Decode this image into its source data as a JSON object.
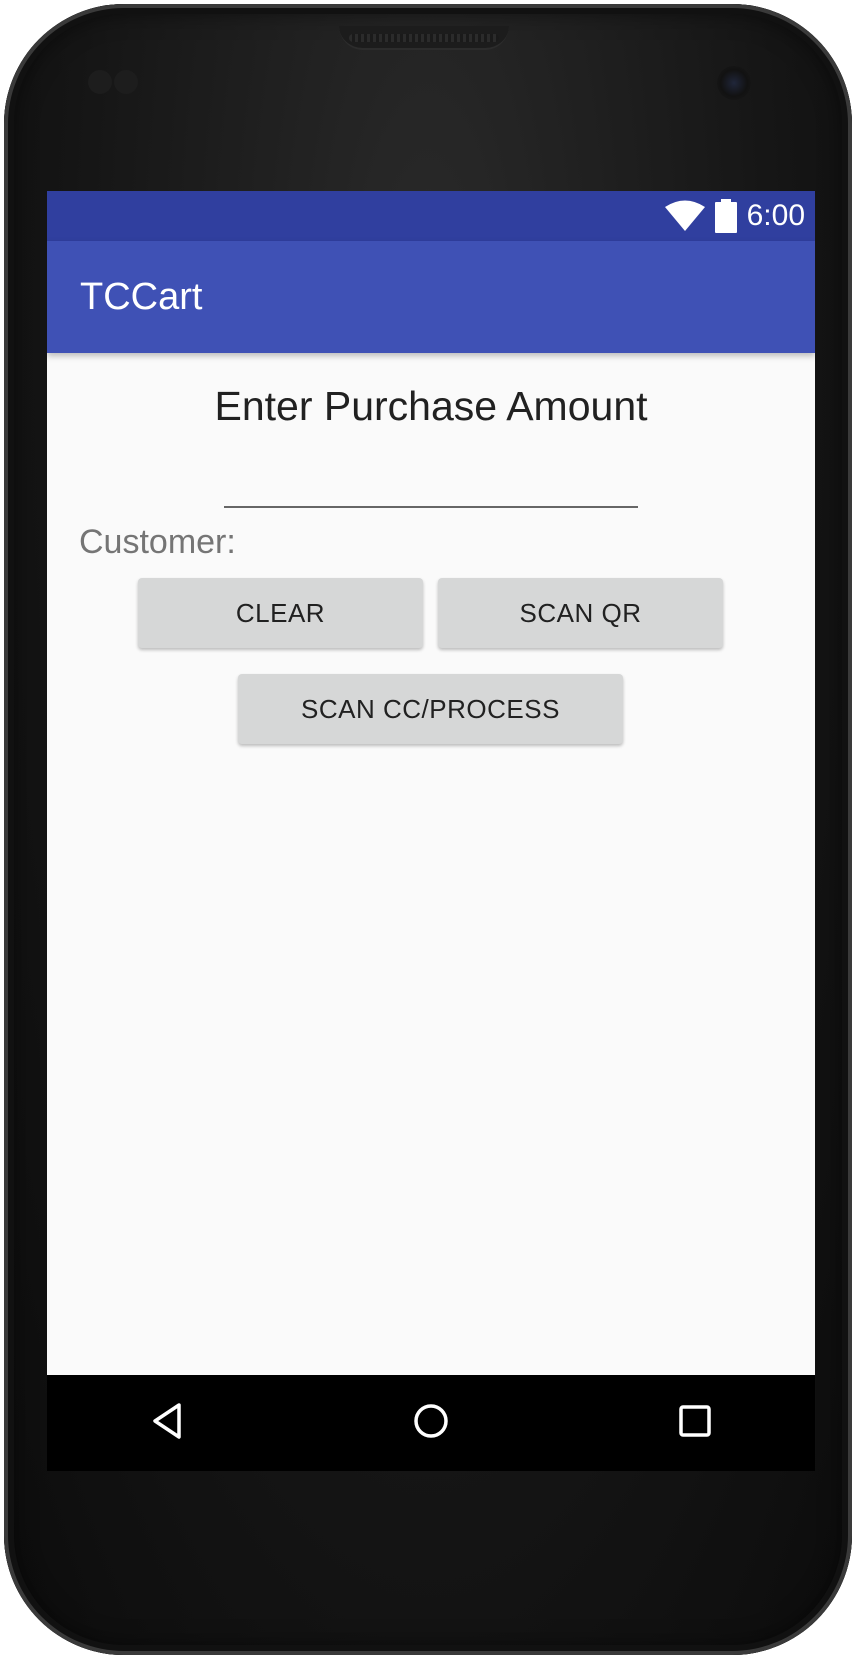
{
  "status_bar": {
    "time": "6:00",
    "icons": [
      "wifi-icon",
      "battery-icon"
    ]
  },
  "app_bar": {
    "title": "TCCart"
  },
  "main": {
    "heading": "Enter Purchase Amount",
    "amount_input": {
      "value": "",
      "placeholder": ""
    },
    "customer_label": "Customer:",
    "buttons": {
      "clear": "CLEAR",
      "scan_qr": "SCAN QR",
      "scan_cc_process": "SCAN CC/PROCESS"
    }
  },
  "nav_bar": {
    "icons": [
      "back-icon",
      "home-icon",
      "recents-icon"
    ]
  },
  "colors": {
    "status_bar": "#303f9f",
    "app_bar": "#3f51b5",
    "background": "#fafafa",
    "button": "#d6d7d7"
  }
}
